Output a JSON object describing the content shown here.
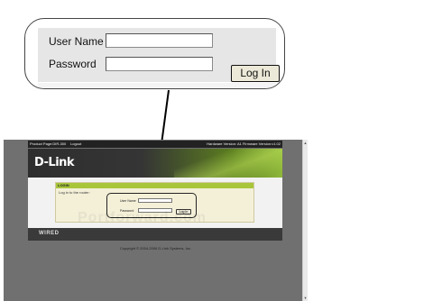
{
  "callout": {
    "username_label": "User Name",
    "password_label": "Password",
    "username_value": "",
    "password_value": "",
    "login_button": "Log In"
  },
  "router": {
    "topbar": {
      "product_page": "Product Page:DIR-300",
      "logout": "Logout",
      "versions": "Hardware Version: A1   Firmware Version:v1.02"
    },
    "brand": "D-Link",
    "login_section": {
      "title": "LOGIN",
      "intro": "Log in to the router:",
      "username_label": "User Name",
      "password_label": "Password",
      "button": "Log In"
    },
    "watermark": "Portforward.com",
    "footer_label": "WIRED",
    "copyright": "Copyright © 2004-2006 D-Link Systems, Inc."
  },
  "colors": {
    "accent_green": "#a9c63b",
    "page_background": "#707070"
  }
}
